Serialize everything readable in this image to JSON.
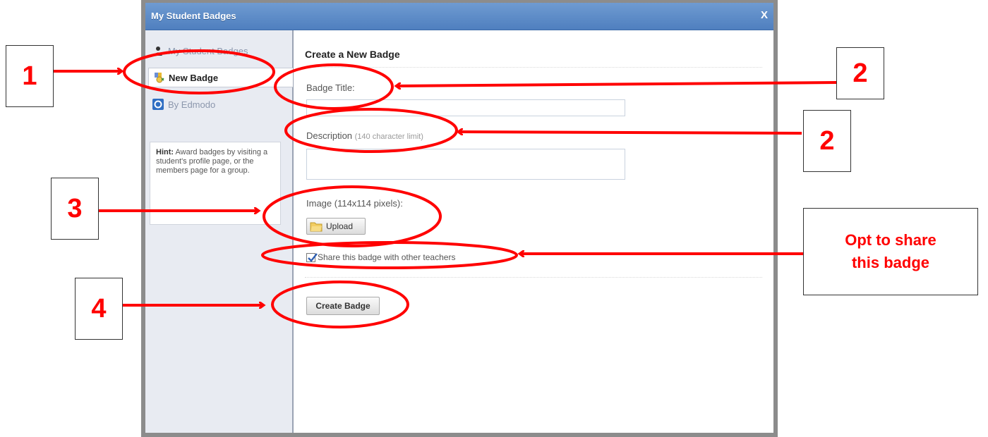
{
  "window": {
    "title": "My Student Badges",
    "close_label": "X"
  },
  "sidebar": {
    "items": [
      {
        "label": "My Student Badges",
        "icon": "person-icon"
      },
      {
        "label": "New Badge",
        "icon": "badge-icon"
      },
      {
        "label": "By Edmodo",
        "icon": "edmodo-icon"
      }
    ],
    "hint_bold": "Hint:",
    "hint_text": " Award badges by visiting a student's profile page, or the members page for a group."
  },
  "form": {
    "heading": "Create a New Badge",
    "title_label": "Badge Title:",
    "title_value": "",
    "description_label": "Description",
    "description_hint": "(140 character limit)",
    "description_value": "",
    "image_label": "Image (114x114 pixels):",
    "upload_label": "Upload",
    "share_label": "Share this badge with other teachers",
    "share_checked": true,
    "submit_label": "Create Badge"
  },
  "annotations": {
    "step1": "1",
    "step2a": "2",
    "step2b": "2",
    "step3": "3",
    "step4": "4",
    "share_note_line1": "Opt to share",
    "share_note_line2": "this badge",
    "color": "#ff0000"
  }
}
